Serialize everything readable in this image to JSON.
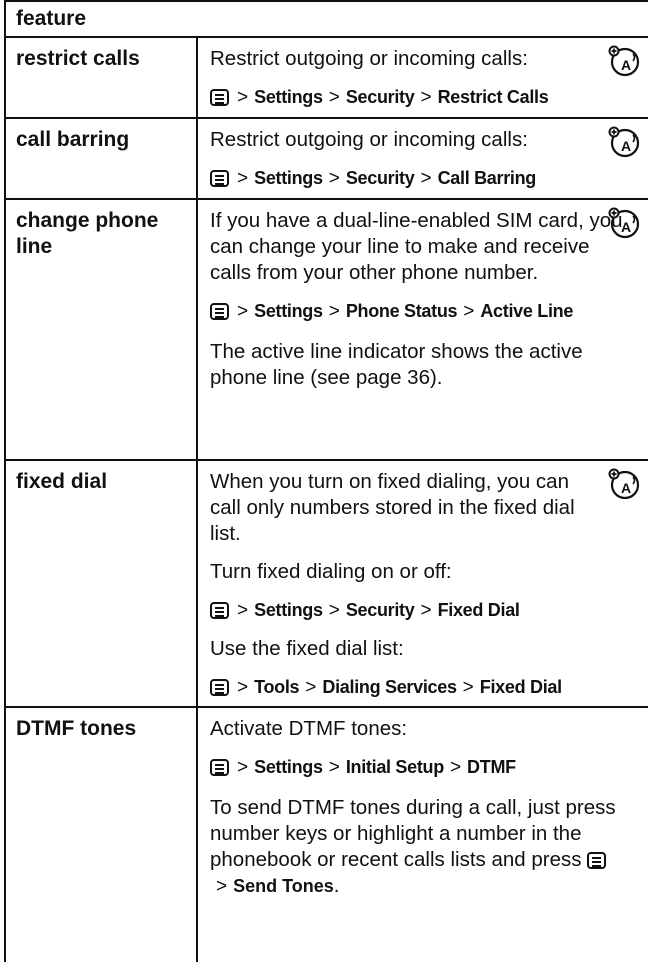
{
  "header": {
    "feature_label": "feature"
  },
  "rows": [
    {
      "feature": "restrict calls",
      "text": "Restrict outgoing or incoming calls:",
      "path": [
        "Settings",
        "Security",
        "Restrict Calls"
      ]
    },
    {
      "feature": "call barring",
      "text": "Restrict outgoing or incoming calls:",
      "path": [
        "Settings",
        "Security",
        "Call Barring"
      ]
    },
    {
      "feature": "change phone line",
      "text": "If you have a dual-line-enabled SIM card, you can change your line to make and receive calls from your other phone number.",
      "path": [
        "Settings",
        "Phone Status",
        "Active Line"
      ],
      "note": "The active line indicator shows the active phone line (see page 36)."
    },
    {
      "feature": "fixed dial",
      "text": "When you turn on fixed dialing, you can call only numbers stored in the fixed dial list.",
      "sub1": "Turn fixed dialing on or off:",
      "path": [
        "Settings",
        "Security",
        "Fixed Dial"
      ],
      "sub2": "Use the fixed dial list:",
      "path2": [
        "Tools",
        "Dialing Services",
        "Fixed Dial"
      ]
    },
    {
      "feature": "DTMF tones",
      "text": "Activate DTMF tones:",
      "path": [
        "Settings",
        "Initial Setup",
        "DTMF"
      ],
      "note_before": "To send DTMF tones during a call, just press number keys or highlight a number in the phonebook or recent calls lists and press",
      "note_path": [
        "Send Tones"
      ],
      "note_after": "."
    }
  ],
  "icons": {
    "menu_key": "menu-key-icon",
    "network": "network-feature-icon"
  }
}
